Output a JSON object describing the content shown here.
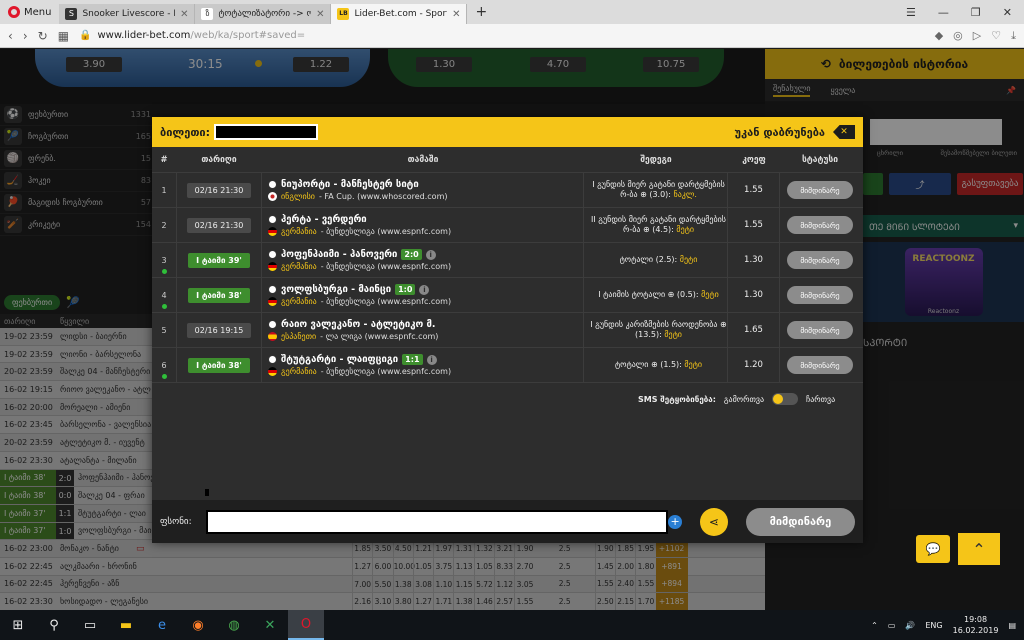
{
  "browser": {
    "menu_label": "Menu",
    "tabs": [
      {
        "title": "Snooker Livescore - Live S",
        "fav_color": "#333333",
        "fav_text": "S"
      },
      {
        "title": "ტოტალიზატორი -> ონ",
        "fav_color": "#ffffff",
        "fav_text": "ზ"
      },
      {
        "title": "Lider-Bet.com - Sports and",
        "fav_color": "#f5c518",
        "fav_text": "LB",
        "active": true
      }
    ],
    "url_host": "www.lider-bet.com",
    "url_path": "/web/ka/sport#saved="
  },
  "hero": {
    "odds": [
      "3.90",
      "1.22",
      "1.30",
      "4.70",
      "10.75"
    ],
    "timer": "30:15"
  },
  "sports": [
    {
      "name": "ფეხბურთი",
      "count": "1331",
      "icon": "⚽"
    },
    {
      "name": "ჩოგბურთი",
      "count": "165",
      "icon": "🎾"
    },
    {
      "name": "ფრენბ.",
      "count": "15",
      "icon": "🏐"
    },
    {
      "name": "ჰოკეი",
      "count": "83",
      "icon": "🏒"
    },
    {
      "name": "მაგიდის ჩოგბურთი",
      "count": "57",
      "icon": "🏓"
    },
    {
      "name": "კრიკეტი",
      "count": "154",
      "icon": "🏏"
    }
  ],
  "live_tabs": {
    "football": "ფეხბურთი"
  },
  "bg_table": {
    "head_date": "თარიღი",
    "head_event": "წყვილი",
    "rows": [
      {
        "time": "19-02 23:59",
        "match": "ლიდსი - ბაიერნი",
        "odds": [
          "",
          "",
          "",
          "",
          "",
          "",
          "",
          "",
          ""
        ],
        "line": "",
        "plus": ""
      },
      {
        "time": "19-02 23:59",
        "match": "ლიონი - ბარსელონა",
        "odds": [
          "",
          "",
          "",
          "",
          "",
          "",
          "",
          "",
          ""
        ],
        "line": "",
        "plus": ""
      },
      {
        "time": "20-02 23:59",
        "match": "შალკე 04 - მანჩესტერი",
        "odds": [
          "",
          "",
          "",
          "",
          "",
          "",
          "",
          "",
          ""
        ],
        "line": "",
        "plus": ""
      },
      {
        "time": "16-02 19:15",
        "match": "რიოო ვალეკანო - ატლ",
        "odds": [
          "",
          "",
          "",
          "",
          "",
          "",
          "",
          "",
          ""
        ],
        "line": "",
        "plus": ""
      },
      {
        "time": "16-02 20:00",
        "match": "მორეალი - ამიენი",
        "odds": [
          "",
          "",
          "",
          "",
          "",
          "",
          "",
          "",
          ""
        ],
        "line": "",
        "plus": ""
      },
      {
        "time": "16-02 23:45",
        "match": "ბარსელონა - ვალენსია",
        "odds": [
          "",
          "",
          "",
          "",
          "",
          "",
          "",
          "",
          ""
        ],
        "line": "",
        "plus": ""
      },
      {
        "time": "20-02 23:59",
        "match": "ატლეტიკო მ. - იუვენტ",
        "odds": [
          "",
          "",
          "",
          "",
          "",
          "",
          "",
          "",
          ""
        ],
        "line": "",
        "plus": ""
      },
      {
        "time": "16-02 23:30",
        "match": "ატალანტა - მილანი",
        "odds": [
          "",
          "",
          "",
          "",
          "",
          "",
          "",
          "",
          ""
        ],
        "line": "",
        "plus": ""
      },
      {
        "time": "I ტაიმი 38'",
        "live": true,
        "score": "2:0",
        "match": "ჰოფენჰაიმი - ჰანოვერი",
        "odds": [
          "",
          "",
          "",
          "",
          "",
          "",
          "",
          "",
          ""
        ],
        "line": "",
        "plus": ""
      },
      {
        "time": "I ტაიმი 38'",
        "live": true,
        "score": "0:0",
        "match": "შალკე 04 - ფრაი",
        "odds": [
          "",
          "",
          "",
          "",
          "",
          "",
          "",
          "",
          ""
        ],
        "line": "",
        "plus": ""
      },
      {
        "time": "I ტაიმი 37'",
        "live": true,
        "score": "1:1",
        "match": "შტუტგარტი - ლაი",
        "odds": [
          "",
          "",
          "",
          "",
          "",
          "",
          "",
          "",
          ""
        ],
        "line": "",
        "plus": ""
      },
      {
        "time": "I ტაიმი 37'",
        "live": true,
        "score": "1:0",
        "match": "ვოლფსბურგი - მაი",
        "odds": [
          "",
          "",
          "",
          "",
          "",
          "",
          "",
          "",
          ""
        ],
        "line": "",
        "plus": ""
      },
      {
        "time": "16-02 23:00",
        "match": "მონაკო - ნანტი",
        "odds": [
          "1.85",
          "3.50",
          "4.50",
          "1.21",
          "1.97",
          "1.31",
          "1.32",
          "3.21",
          "1.90"
        ],
        "line": "2.5",
        "odds2": [
          "1.90",
          "1.85",
          "1.95"
        ],
        "plus": "+1102"
      },
      {
        "time": "16-02 22:45",
        "match": "ალკმაარი - ხრონინ",
        "odds": [
          "1.27",
          "6.00",
          "10.00",
          "1.05",
          "3.75",
          "1.13",
          "1.05",
          "8.33",
          "2.70"
        ],
        "line": "2.5",
        "odds2": [
          "1.45",
          "2.00",
          "1.80"
        ],
        "plus": "+891"
      },
      {
        "time": "16-02 22:45",
        "match": "ჰერენვენი - აზნ",
        "odds": [
          "7.00",
          "5.50",
          "1.38",
          "3.08",
          "1.10",
          "1.15",
          "5.72",
          "1.12",
          "3.05"
        ],
        "line": "2.5",
        "odds2": [
          "1.55",
          "2.40",
          "1.55"
        ],
        "plus": "+894"
      },
      {
        "time": "16-02 23:30",
        "match": "ხოსიდადო - ლეგანესი",
        "odds": [
          "2.16",
          "3.10",
          "3.80",
          "1.27",
          "1.71",
          "1.38",
          "1.46",
          "2.57",
          "1.55"
        ],
        "line": "2.5",
        "odds2": [
          "2.50",
          "2.15",
          "1.70"
        ],
        "plus": "+1185"
      }
    ]
  },
  "right": {
    "history_title": "ბილეთების ისტორია",
    "tab_saved": "შენახული",
    "tab_all": "ყველა",
    "label_left": "ცხრილი",
    "label_right": "შესამოწმებელი ბილეთი",
    "btn_clear": "გასუფთავება",
    "casino_label": "ᲗᲔ ᲛᲘᲜᲘ ᲡᲚᲝᲢᲔᲑᲘ",
    "casino_game": "REACTOONZ",
    "casino_game_sub": "Reactoonz",
    "tail_text": "ᲡᲞᲝᲠᲢᲘ"
  },
  "modal": {
    "ticket_label": "ბილეთი:",
    "back_label": "უკან დაბრუნება",
    "back_icon": "close-icon",
    "columns": {
      "num": "#",
      "date": "თარიღი",
      "match": "თამაში",
      "event": "შედეგი",
      "odd": "კოეფ",
      "status": "სტატუსი"
    },
    "rows": [
      {
        "num": "1",
        "date": "02/16 21:30",
        "live": false,
        "match": "ნიუპორტი - მანჩესტერ სიტი",
        "flag": "england",
        "country": "ინგლისი",
        "league": "- FA Cup. (www.whoscored.com)",
        "event": "I გუნდის მიერ გატანი დარტყმების რ-ბა ⊕ (3.0):",
        "pick": "ნაკლ.",
        "odd": "1.55",
        "status": "მიმდინარე"
      },
      {
        "num": "2",
        "date": "02/16 21:30",
        "live": false,
        "match": "ჰერტა - ვერდერი",
        "flag": "germany",
        "country": "გერმანია",
        "league": "- ბუნდესლიგა (www.espnfc.com)",
        "event": "II გუნდის მიერ გატანი დარტყმების რ-ბა ⊕ (4.5):",
        "pick": "მეტი",
        "odd": "1.55",
        "status": "მიმდინარე"
      },
      {
        "num": "3",
        "date": "I ტაიმი 39'",
        "live": true,
        "match": "ჰოფენჰაიმი - ჰანოვერი",
        "score": "2:0",
        "flag": "germany",
        "country": "გერმანია",
        "league": "- ბუნდესლიგა (www.espnfc.com)",
        "event": "ტოტალი (2.5):",
        "pick": "მეტი",
        "odd": "1.30",
        "status": "მიმდინარე"
      },
      {
        "num": "4",
        "date": "I ტაიმი 38'",
        "live": true,
        "match": "ვოლფსბურგი - მაინცი",
        "score": "1:0",
        "flag": "germany",
        "country": "გერმანია",
        "league": "- ბუნდესლიგა (www.espnfc.com)",
        "event": "I ტაიმის ტოტალი ⊕ (0.5):",
        "pick": "მეტი",
        "odd": "1.30",
        "status": "მიმდინარე"
      },
      {
        "num": "5",
        "date": "02/16 19:15",
        "live": false,
        "match": "რაიო ვალეკანო - ატლეტიკო მ.",
        "flag": "spain",
        "country": "ესპანეთი",
        "league": "- ლა ლიგა (www.espnfc.com)",
        "event": "I გუნდის კარიზმების რაოდენობა ⊕ (13.5):",
        "pick": "მეტი",
        "odd": "1.65",
        "status": "მიმდინარე"
      },
      {
        "num": "6",
        "date": "I ტაიმი 38'",
        "live": true,
        "match": "შტუტგარტი - ლაიფციგი",
        "score": "1:1",
        "flag": "germany",
        "country": "გერმანია",
        "league": "- ბუნდესლიგა (www.espnfc.com)",
        "event": "ტოტალი ⊕ (1.5):",
        "pick": "მეტი",
        "odd": "1.20",
        "status": "მიმდინარე"
      }
    ],
    "sms_label": "SMS შეტყობინება:",
    "sms_on": "გამორთვა",
    "sms_off": "ჩართვა",
    "amount_label": "ფსონი:",
    "continue_label": "მიმდინარე"
  },
  "taskbar": {
    "lang": "ENG",
    "time": "19:08",
    "date": "16.02.2019"
  },
  "colors": {
    "accent": "#f5c518",
    "live_green": "#3e8e2e",
    "status_gray": "#8c8c8c"
  }
}
